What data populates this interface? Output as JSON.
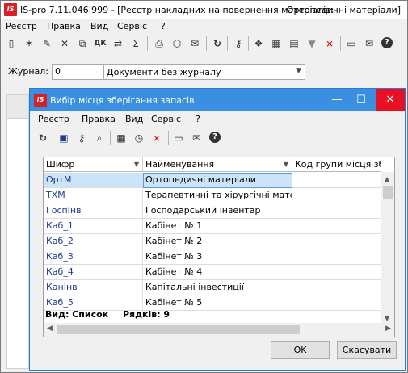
{
  "main": {
    "logo_text": "IS",
    "title": "IS-pro 7.11.046.999 - [Реєстр накладних на повернення матеріалів:",
    "title_right": "Ортопедичні матеріали]",
    "menu": [
      "Реєстр",
      "Правка",
      "Вид",
      "Сервіс",
      "?"
    ],
    "journal_label": "Журнал:",
    "journal_number": "0",
    "journal_value": "Документи без журналу"
  },
  "dialog": {
    "logo_text": "IS",
    "title": "Вибір місця зберігання запасів",
    "menu": [
      "Реєстр",
      "Правка",
      "Вид",
      "Сервіс",
      "?"
    ],
    "columns": [
      "Шифр",
      "Найменування",
      "Код групи місця зберіг"
    ],
    "rows": [
      {
        "code": "ОртМ",
        "name": "Ортопедичні матеріали"
      },
      {
        "code": "ТХМ",
        "name": "Терапевтичні та хірургічні матері..."
      },
      {
        "code": "ГоспІнв",
        "name": "Господарський інвентар"
      },
      {
        "code": "Каб_1",
        "name": "Кабінет № 1"
      },
      {
        "code": "Каб_2",
        "name": "Кабінет № 2"
      },
      {
        "code": "Каб_3",
        "name": "Кабінет № 3"
      },
      {
        "code": "Каб_4",
        "name": "Кабінет № 4"
      },
      {
        "code": "КанІнв",
        "name": "Капітальні інвестиції"
      },
      {
        "code": "Каб_5",
        "name": "Кабінет № 5"
      }
    ],
    "status_view": "Вид: Список",
    "status_rows": "Рядків: 9",
    "ok_label": "OK",
    "cancel_label": "Скасувати"
  },
  "colors": {
    "accent": "#3b8fe0",
    "close": "#e81123",
    "logo": "#d62027",
    "selection": "#cce4f7"
  }
}
